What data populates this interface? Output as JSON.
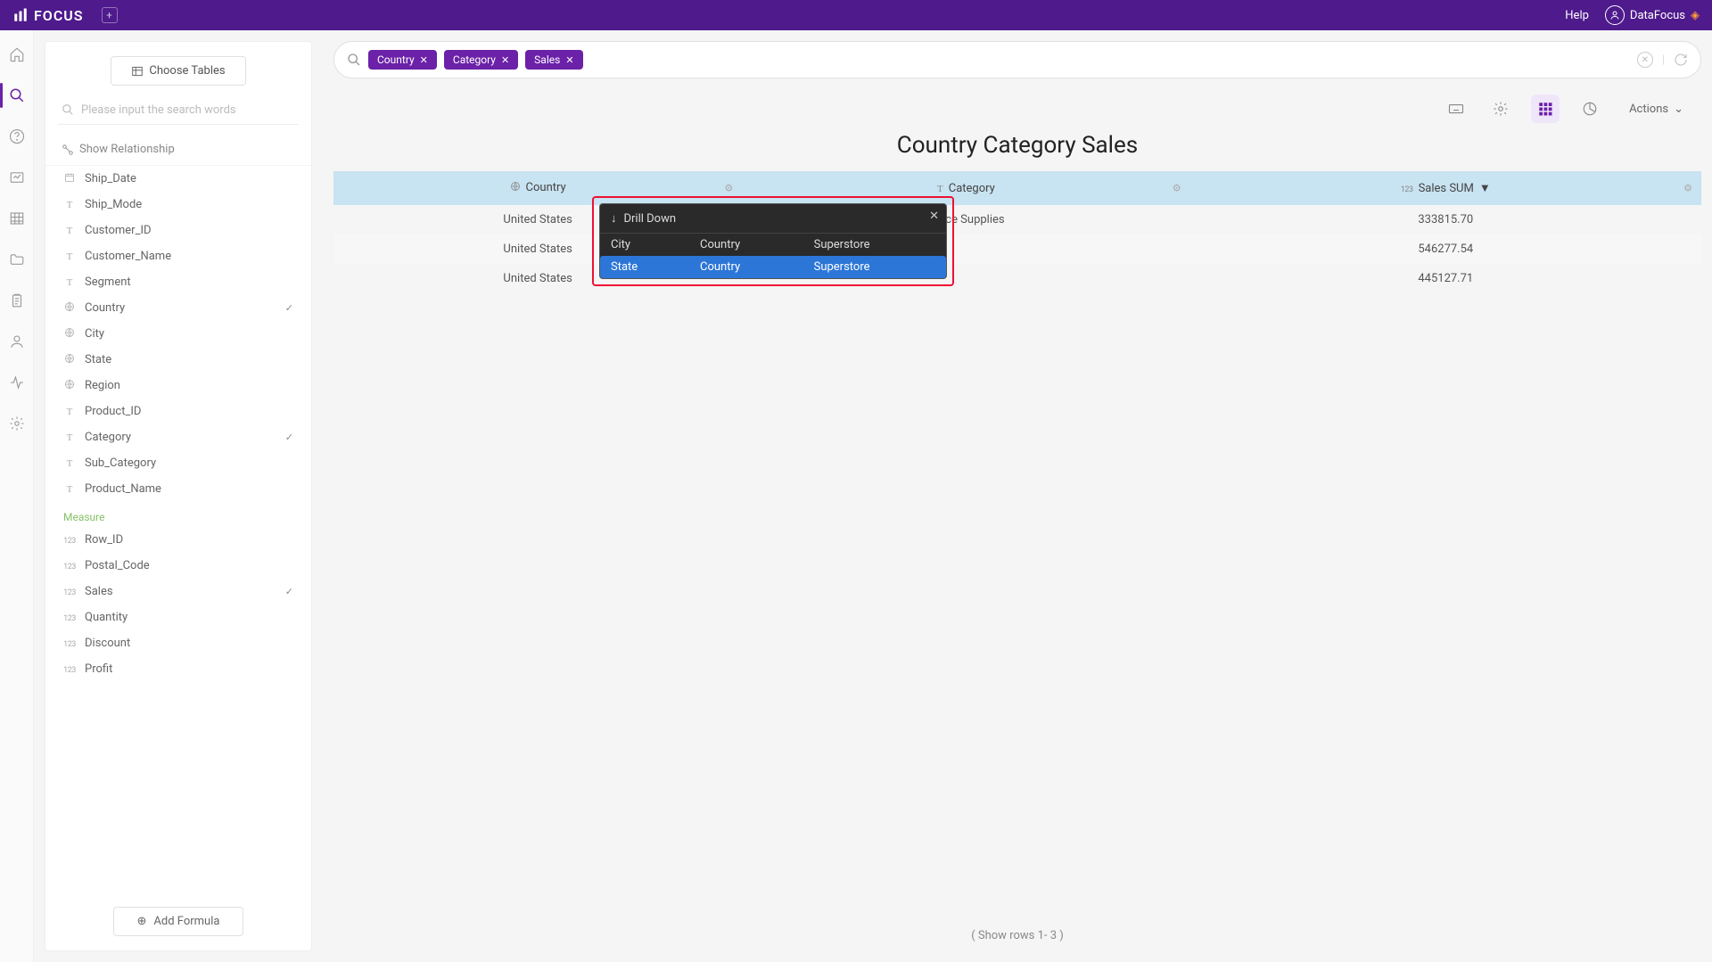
{
  "header": {
    "logo": "FOCUS",
    "help": "Help",
    "user": "DataFocus"
  },
  "sidepanel": {
    "choose_tables": "Choose Tables",
    "search_placeholder": "Please input the search words",
    "show_relationship": "Show Relationship",
    "measure_label": "Measure",
    "add_formula": "Add Formula",
    "attribute_fields": [
      {
        "icon": "cal",
        "label": "Ship_Date",
        "checked": false
      },
      {
        "icon": "T",
        "label": "Ship_Mode",
        "checked": false
      },
      {
        "icon": "T",
        "label": "Customer_ID",
        "checked": false
      },
      {
        "icon": "T",
        "label": "Customer_Name",
        "checked": false
      },
      {
        "icon": "T",
        "label": "Segment",
        "checked": false
      },
      {
        "icon": "geo",
        "label": "Country",
        "checked": true
      },
      {
        "icon": "geo",
        "label": "City",
        "checked": false
      },
      {
        "icon": "geo",
        "label": "State",
        "checked": false
      },
      {
        "icon": "geo",
        "label": "Region",
        "checked": false
      },
      {
        "icon": "T",
        "label": "Product_ID",
        "checked": false
      },
      {
        "icon": "T",
        "label": "Category",
        "checked": true
      },
      {
        "icon": "T",
        "label": "Sub_Category",
        "checked": false
      },
      {
        "icon": "T",
        "label": "Product_Name",
        "checked": false
      }
    ],
    "measure_fields": [
      {
        "icon": "123",
        "label": "Row_ID",
        "checked": false
      },
      {
        "icon": "123",
        "label": "Postal_Code",
        "checked": false
      },
      {
        "icon": "123",
        "label": "Sales",
        "checked": true
      },
      {
        "icon": "123",
        "label": "Quantity",
        "checked": false
      },
      {
        "icon": "123",
        "label": "Discount",
        "checked": false
      },
      {
        "icon": "123",
        "label": "Profit",
        "checked": false
      }
    ]
  },
  "query": {
    "chips": [
      "Country",
      "Category",
      "Sales"
    ]
  },
  "toolbar": {
    "actions": "Actions"
  },
  "chart": {
    "title": "Country Category Sales",
    "columns": [
      {
        "icon": "geo",
        "label": "Country"
      },
      {
        "icon": "T",
        "label": "Category"
      },
      {
        "icon": "123",
        "label": "Sales SUM",
        "sorted": true
      }
    ],
    "rows": [
      {
        "c0": "United States",
        "c1": "Office Supplies",
        "c2": "333815.70"
      },
      {
        "c0": "United States",
        "c1": "",
        "c2": "546277.54"
      },
      {
        "c0": "United States",
        "c1": "",
        "c2": "445127.71"
      }
    ],
    "footer": "( Show rows 1- 3 )"
  },
  "popup": {
    "title": "Drill Down",
    "options": [
      {
        "c0": "City",
        "c1": "Country",
        "c2": "Superstore",
        "selected": false
      },
      {
        "c0": "State",
        "c1": "Country",
        "c2": "Superstore",
        "selected": true
      }
    ]
  }
}
